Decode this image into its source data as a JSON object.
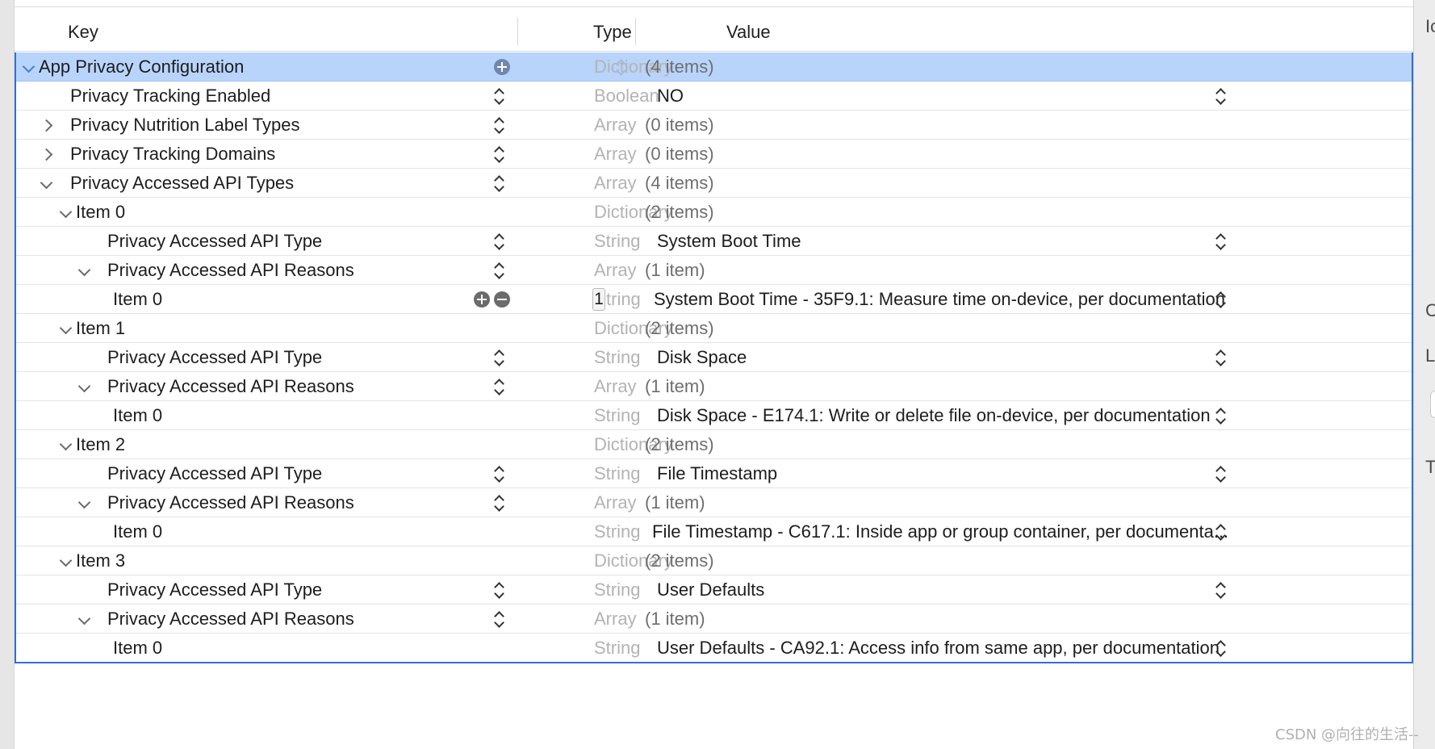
{
  "header": {
    "key": "Key",
    "type": "Type",
    "value": "Value"
  },
  "rows": [
    {
      "key": "App Privacy Configuration",
      "type": "Dictionary",
      "value": "(4 items)"
    },
    {
      "key": "Privacy Tracking Enabled",
      "type": "Boolean",
      "value": "NO"
    },
    {
      "key": "Privacy Nutrition Label Types",
      "type": "Array",
      "value": "(0 items)"
    },
    {
      "key": "Privacy Tracking Domains",
      "type": "Array",
      "value": "(0 items)"
    },
    {
      "key": "Privacy Accessed API Types",
      "type": "Array",
      "value": "(4 items)"
    },
    {
      "key": "Item 0",
      "type": "Dictionary",
      "value": "(2 items)"
    },
    {
      "key": "Privacy Accessed API Type",
      "type": "String",
      "value": "System Boot Time"
    },
    {
      "key": "Privacy Accessed API Reasons",
      "type": "Array",
      "value": "(1 item)"
    },
    {
      "key": "Item 0",
      "type": "tring",
      "value": "System Boot Time - 35F9.1: Measure time on-device, per documentation",
      "cursor": "1"
    },
    {
      "key": "Item 1",
      "type": "Dictionary",
      "value": "(2 items)"
    },
    {
      "key": "Privacy Accessed API Type",
      "type": "String",
      "value": "Disk Space"
    },
    {
      "key": "Privacy Accessed API Reasons",
      "type": "Array",
      "value": "(1 item)"
    },
    {
      "key": "Item 0",
      "type": "String",
      "value": "Disk Space - E174.1: Write or delete file on-device, per documentation"
    },
    {
      "key": "Item 2",
      "type": "Dictionary",
      "value": "(2 items)"
    },
    {
      "key": "Privacy Accessed API Type",
      "type": "String",
      "value": "File Timestamp"
    },
    {
      "key": "Privacy Accessed API Reasons",
      "type": "Array",
      "value": "(1 item)"
    },
    {
      "key": "Item 0",
      "type": "String",
      "value": "File Timestamp - C617.1: Inside app or group container, per documenta..."
    },
    {
      "key": "Item 3",
      "type": "Dictionary",
      "value": "(2 items)"
    },
    {
      "key": "Privacy Accessed API Type",
      "type": "String",
      "value": "User Defaults"
    },
    {
      "key": "Privacy Accessed API Reasons",
      "type": "Array",
      "value": "(1 item)"
    },
    {
      "key": "Item 0",
      "type": "String",
      "value": "User Defaults - CA92.1: Access info from same app, per documentation"
    }
  ],
  "right_panel": [
    "Ic",
    "C",
    "L",
    "T"
  ],
  "watermark": "CSDN @向往的生活--"
}
